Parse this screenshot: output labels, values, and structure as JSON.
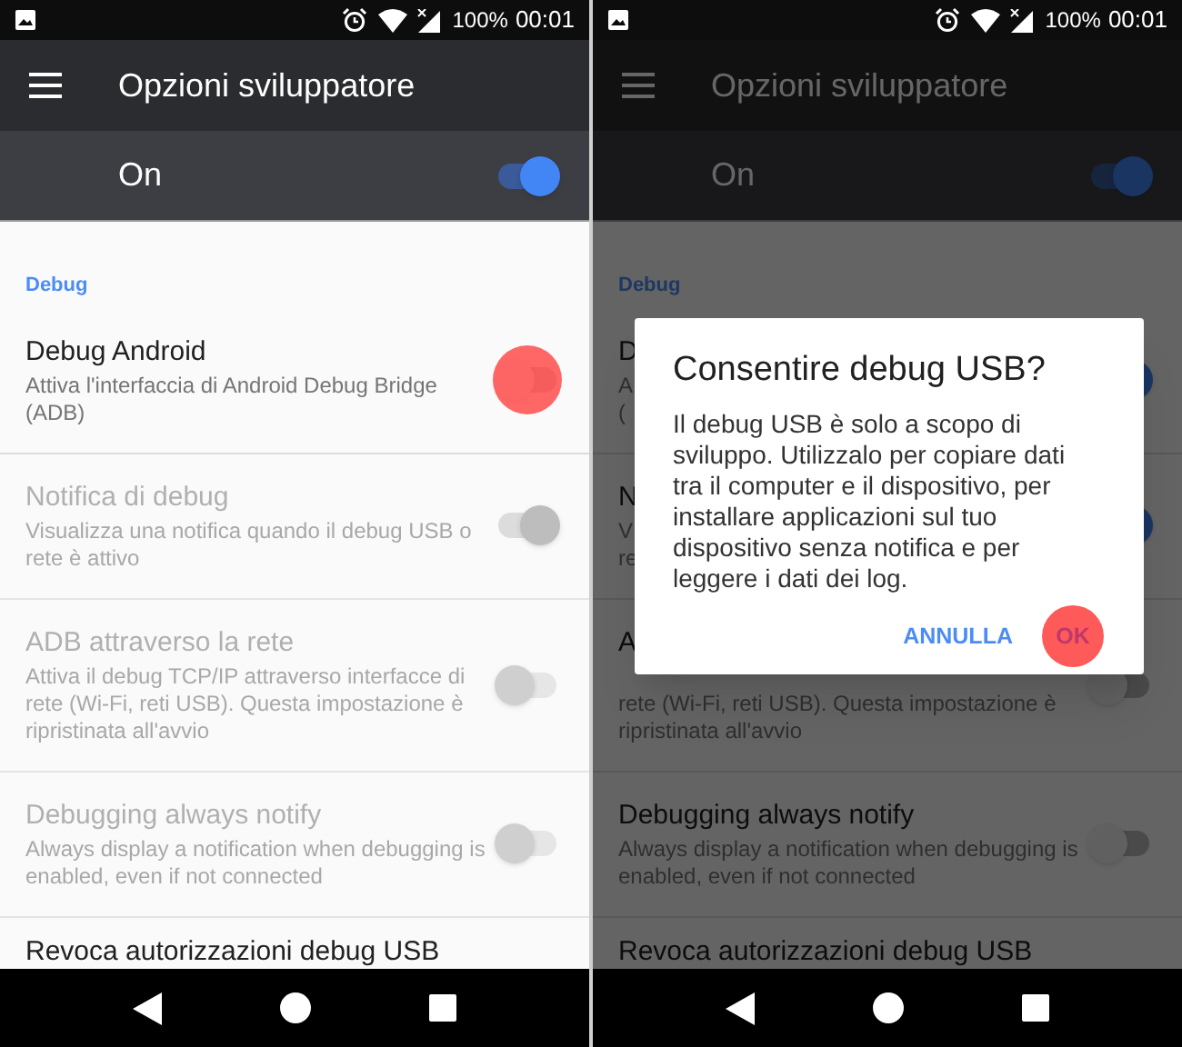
{
  "screens": [
    {
      "status_bar": {
        "battery": "100%",
        "time": "00:01"
      },
      "toolbar": {
        "title": "Opzioni sviluppatore"
      },
      "master_switch": {
        "label": "On",
        "on": true
      },
      "section": "Debug",
      "items": [
        {
          "kind": "switch",
          "title": "Debug Android",
          "description": "Attiva l'interfaccia di Android Debug Bridge (ADB)",
          "on": false,
          "enabled": true,
          "touched": true
        },
        {
          "kind": "switch",
          "title": "Notifica di debug",
          "description": "Visualizza una notifica quando il debug USB o rete è attivo",
          "on": true,
          "enabled": false,
          "touched": false
        },
        {
          "kind": "switch",
          "title": "ADB attraverso la rete",
          "description": "Attiva il debug TCP/IP attraverso interfacce di rete (Wi-Fi, reti USB). Questa impostazione è ripristinata all'avvio",
          "on": false,
          "enabled": false,
          "touched": false
        },
        {
          "kind": "switch",
          "title": "Debugging always notify",
          "description": "Always display a notification when debugging is enabled, even if not connected",
          "on": false,
          "enabled": false,
          "touched": false
        },
        {
          "kind": "plain",
          "title": "Revoca autorizzazioni debug USB"
        }
      ]
    },
    {
      "status_bar": {
        "battery": "100%",
        "time": "00:01"
      },
      "toolbar": {
        "title": "Opzioni sviluppatore"
      },
      "master_switch": {
        "label": "On",
        "on": true
      },
      "section": "Debug",
      "items": [
        {
          "kind": "switch",
          "title": "D",
          "description": "A\n(",
          "on": true,
          "enabled": true,
          "touched": false
        },
        {
          "kind": "switch",
          "title": "N",
          "description": "V\nre",
          "on": true,
          "enabled": true,
          "touched": false
        },
        {
          "kind": "switch",
          "title": "A",
          "description": "\nrete (Wi-Fi, reti USB). Questa impostazione è\nripristinata all'avvio",
          "on": false,
          "enabled": true,
          "touched": false
        },
        {
          "kind": "switch",
          "title": "Debugging always notify",
          "description": "Always display a notification when debugging is enabled, even if not connected",
          "on": false,
          "enabled": true,
          "touched": false
        },
        {
          "kind": "plain",
          "title": "Revoca autorizzazioni debug USB"
        }
      ],
      "dialog": {
        "title": "Consentire debug USB?",
        "message": "Il debug USB è solo a scopo di sviluppo. Utilizzalo per copiare dati tra il computer e il dispositivo, per installare applicazioni sul tuo dispositivo senza notifica e per leggere i dati dei log.",
        "buttons": [
          {
            "label": "ANNULLA",
            "touched": false
          },
          {
            "label": "OK",
            "touched": true
          }
        ]
      }
    }
  ]
}
